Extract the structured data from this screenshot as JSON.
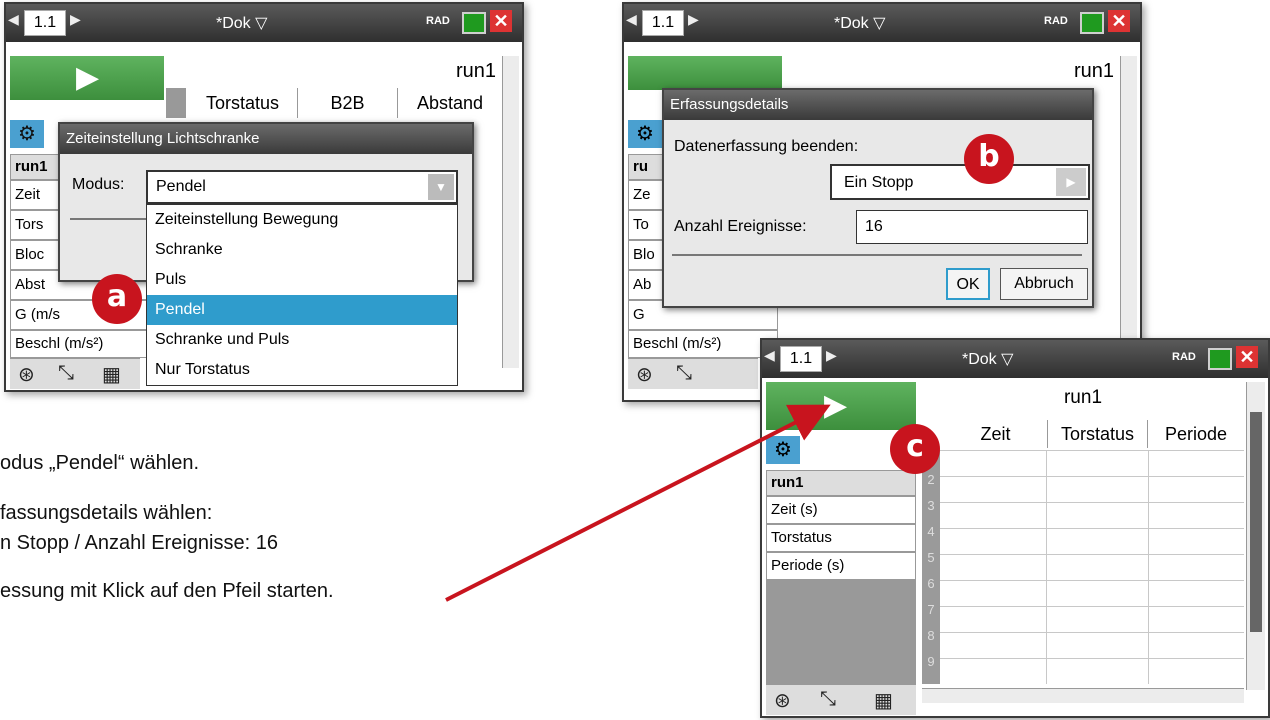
{
  "common": {
    "tab_label": "1.1",
    "doc_title": "*Dok",
    "angle_mode": "RAD"
  },
  "screen_a": {
    "table_name": "run1",
    "columns": [
      "Torstatus",
      "B2B",
      "Abstand"
    ],
    "sidebar": [
      "run1",
      "Zeit",
      "Tors",
      "Bloc",
      "Abst",
      "G (m/s",
      "Beschl (m/s²)"
    ],
    "dialog_title": "Zeiteinstellung Lichtschranke",
    "modus_label": "Modus:",
    "modus_value": "Pendel",
    "options": [
      "Zeiteinstellung Bewegung",
      "Schranke",
      "Puls",
      "Pendel",
      "Schranke und Puls",
      "Nur Torstatus"
    ],
    "selected_index": 3,
    "badge": "a"
  },
  "screen_b": {
    "table_name": "run1",
    "sidebar": [
      "ru",
      "Ze",
      "To",
      "Blo",
      "Ab",
      "G",
      "Beschl (m/s²)"
    ],
    "dialog_title": "Erfassungsdetails",
    "end_label": "Datenerfassung beenden:",
    "end_value": "Ein Stopp",
    "count_label": "Anzahl Ereignisse:",
    "count_value": "16",
    "ok_label": "OK",
    "cancel_label": "Abbruch",
    "badge": "b"
  },
  "screen_c": {
    "table_name": "run1",
    "columns": [
      "Zeit",
      "Torstatus",
      "Periode"
    ],
    "sidebar": [
      "run1",
      "Zeit (s)",
      "Torstatus",
      "Periode (s)"
    ],
    "row_numbers": [
      "1",
      "2",
      "3",
      "4",
      "5",
      "6",
      "7",
      "8",
      "9"
    ],
    "badge": "c"
  },
  "captions": [
    "odus „Pendel“ wählen.",
    "fassungsdetails wählen:",
    "n Stopp / Anzahl Ereignisse: 16",
    "essung mit Klick auf den Pfeil starten."
  ],
  "colors": {
    "accent": "#c8141e",
    "select": "#2f9ccc",
    "start": "#4aa04a"
  }
}
